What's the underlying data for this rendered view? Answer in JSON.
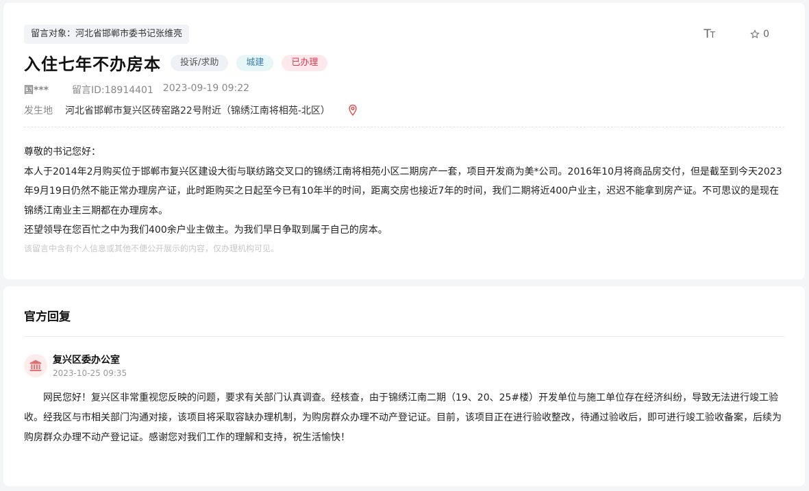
{
  "message": {
    "target": "留言对象：河北省邯郸市委书记张维亮",
    "title": "入住七年不办房本",
    "tags": {
      "type": "投诉/求助",
      "field": "城建",
      "status": "已办理"
    },
    "author": "国***",
    "message_id": "留言ID:18914401",
    "datetime": "2023-09-19 09:22",
    "location_label": "发生地",
    "location": "河北省邯郸市复兴区砖窑路22号附近（锦绣江南将相苑-北区）",
    "favorite_count": "0",
    "body": [
      "尊敬的书记您好：",
      "本人于2014年2月购买位于邯郸市复兴区建设大街与联纺路交叉口的锦绣江南将相苑小区二期房产一套，项目开发商为美*公司。2016年10月将商品房交付，但是截至到今天2023年9月19日仍然不能正常办理房产证，此时距购买之日起至今已有10年半的时间，距离交房也接近7年的时间，我们二期将近400户业主，迟迟不能拿到房产证。不可思议的是现在锦绣江南业主三期都在办理房本。",
      "还望领导在您百忙之中为我们400余户业主做主。为我们早日争取到属于自己的房本。"
    ],
    "privacy_note": "该留言中含有个人信息或其他不便公开展示的内容，仅办理机构可见。"
  },
  "reply": {
    "section_title": "官方回复",
    "department": "复兴区委办公室",
    "datetime": "2023-10-25 09:35",
    "body": "网民您好！复兴区非常重视您反映的问题，要求有关部门认真调查。经核查，由于锦绣江南二期（19、20、25#楼）开发单位与施工单位存在经济纠纷，导致无法进行竣工验收。经我区与市相关部门沟通对接，该项目将采取容缺办理机制，为购房群众办理不动产登记证。目前，该项目正在进行验收整改，待通过验收后，即可进行竣工验收备案，后续为购房群众办理不动产登记证。感谢您对我们工作的理解和支持，祝生活愉快！"
  },
  "icons": {
    "font_size": "font-size-icon",
    "favorite": "star-outline-icon",
    "location": "map-pin-icon",
    "department": "bank-building-icon"
  },
  "colors": {
    "status_red": "#e2374b",
    "field_blue": "#3a7fa8",
    "pin_red": "#e24a4a"
  }
}
